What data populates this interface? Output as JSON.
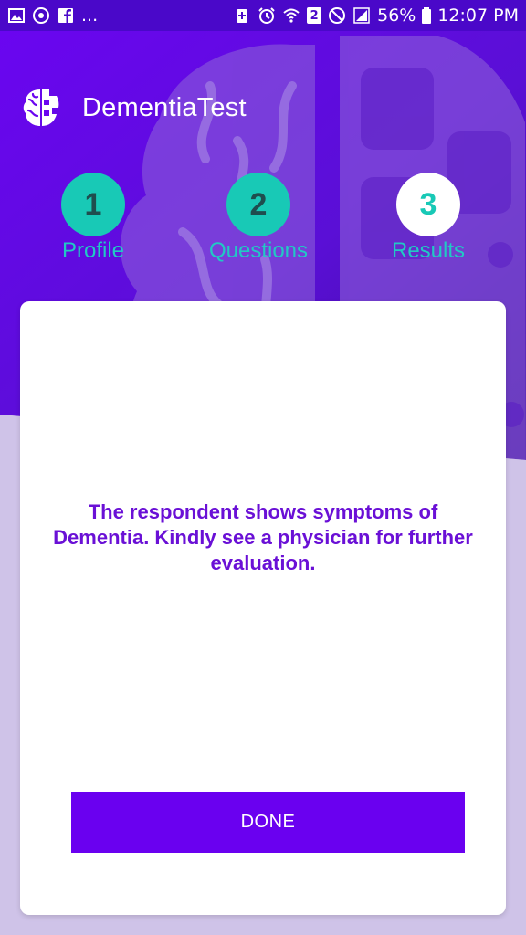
{
  "status_bar": {
    "left_icons": [
      "gallery-icon",
      "power-saving-icon",
      "facebook-icon"
    ],
    "ellipsis": "...",
    "sim_badge": "2",
    "battery_percent": "56%",
    "time": "12:07 PM"
  },
  "app": {
    "title": "DementiaTest"
  },
  "stepper": {
    "steps": [
      {
        "number": "1",
        "label": "Profile",
        "state": "done"
      },
      {
        "number": "2",
        "label": "Questions",
        "state": "done"
      },
      {
        "number": "3",
        "label": "Results",
        "state": "active"
      }
    ]
  },
  "result": {
    "message": "The respondent shows symptoms of Dementia. Kindly see a physician for further evaluation.",
    "done_label": "DONE"
  },
  "colors": {
    "primary": "#6a00f0",
    "accent_teal": "#18c9b6",
    "background": "#cfc3e8"
  }
}
